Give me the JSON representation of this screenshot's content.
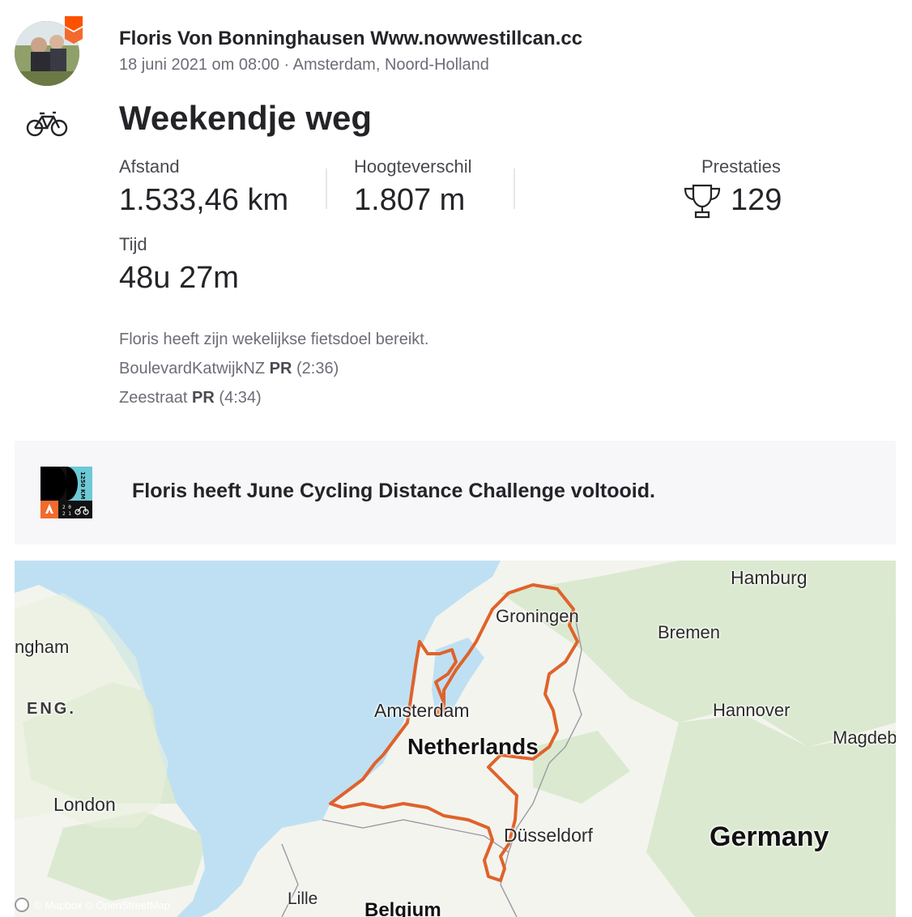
{
  "athlete": {
    "name": "Floris Von Bonninghausen Www.nowwestillcan.cc",
    "meta": "18 juni 2021 om 08:00 · Amsterdam, Noord-Holland"
  },
  "activity": {
    "type_icon": "bicycle-icon",
    "title": "Weekendje weg"
  },
  "stats": {
    "distance": {
      "label": "Afstand",
      "value": "1.533,46 km"
    },
    "elevation": {
      "label": "Hoogteverschil",
      "value": "1.807 m"
    },
    "time": {
      "label": "Tijd",
      "value": "48u 27m"
    },
    "achievements": {
      "label": "Prestaties",
      "value": "129"
    }
  },
  "description": {
    "goal": "Floris heeft zijn wekelijkse fietsdoel bereikt.",
    "segments": [
      {
        "name": "BoulevardKatwijkNZ",
        "pr": "PR",
        "time": "(2:36)"
      },
      {
        "name": "Zeestraat",
        "pr": "PR",
        "time": "(4:34)"
      }
    ]
  },
  "challenge": {
    "badge_text": "1250 KM",
    "badge_year": "2021",
    "text": "Floris heeft June Cycling Distance Challenge voltooid."
  },
  "map": {
    "labels": {
      "hamburg": "Hamburg",
      "groningen": "Groningen",
      "bremen": "Bremen",
      "nottingham": "ngham",
      "eng": "ENG.",
      "amsterdam": "Amsterdam",
      "hannover": "Hannover",
      "netherlands": "Netherlands",
      "magdeburg": "Magdeb",
      "london": "London",
      "dusseldorf": "Düsseldorf",
      "germany": "Germany",
      "lille": "Lille",
      "belgium": "Belgium"
    },
    "attribution": "© Mapbox © OpenStreetMap",
    "route_color": "#e0622a",
    "water_color": "#bfe0f3",
    "land_color": "#f3f4ee"
  }
}
